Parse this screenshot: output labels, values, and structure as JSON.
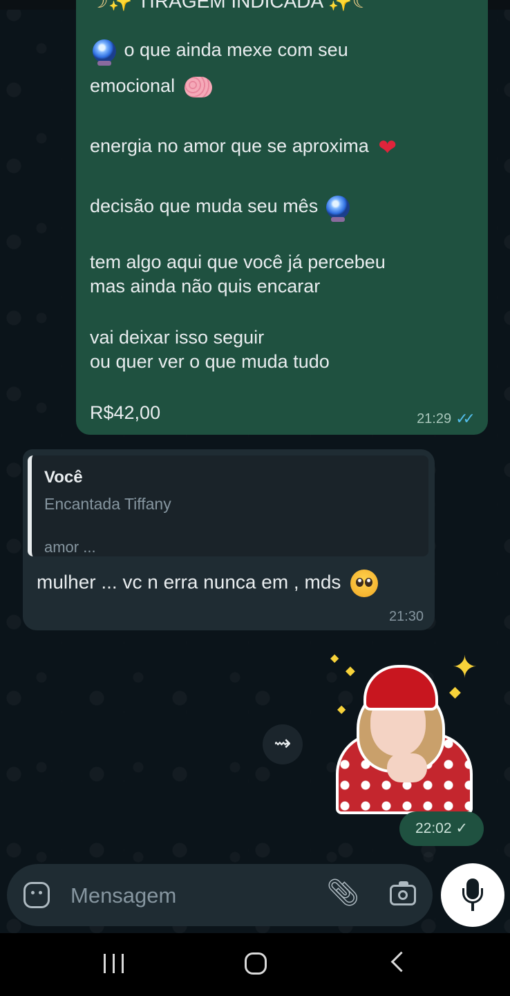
{
  "chat": {
    "outgoing_message": {
      "title": "TIRAGEM INDICADA",
      "line1": "o que ainda mexe com seu",
      "line2": "emocional",
      "line3": "energia no amor que se aproxima",
      "line4": "decisão que muda seu mês",
      "line5": "tem algo aqui que você já percebeu",
      "line6": "mas ainda não quis encarar",
      "line7": "vai deixar isso seguir",
      "line8": "ou quer ver o que muda tudo",
      "price": "R$42,00",
      "time": "21:29",
      "status_icon": "double-check-read-icon",
      "accent": "#53bdeb"
    },
    "incoming_message": {
      "quoted_author": "Você",
      "quoted_name": "Encantada Tiffany",
      "quoted_text": "amor  ...",
      "text": "mulher ... vc n erra nunca em , mds",
      "time": "21:30"
    },
    "sticker_message": {
      "time": "22:02",
      "status_icon": "single-check-icon"
    }
  },
  "composer": {
    "placeholder": "Mensagem"
  },
  "icons": {
    "forward": "forward-icon",
    "sticker": "sticker-icon",
    "attach": "paperclip-icon",
    "camera": "camera-icon",
    "mic": "microphone-icon"
  },
  "colors": {
    "outgoing_bubble": "#1f5140",
    "incoming_bubble": "#1f2c33",
    "background": "#0b141a"
  }
}
